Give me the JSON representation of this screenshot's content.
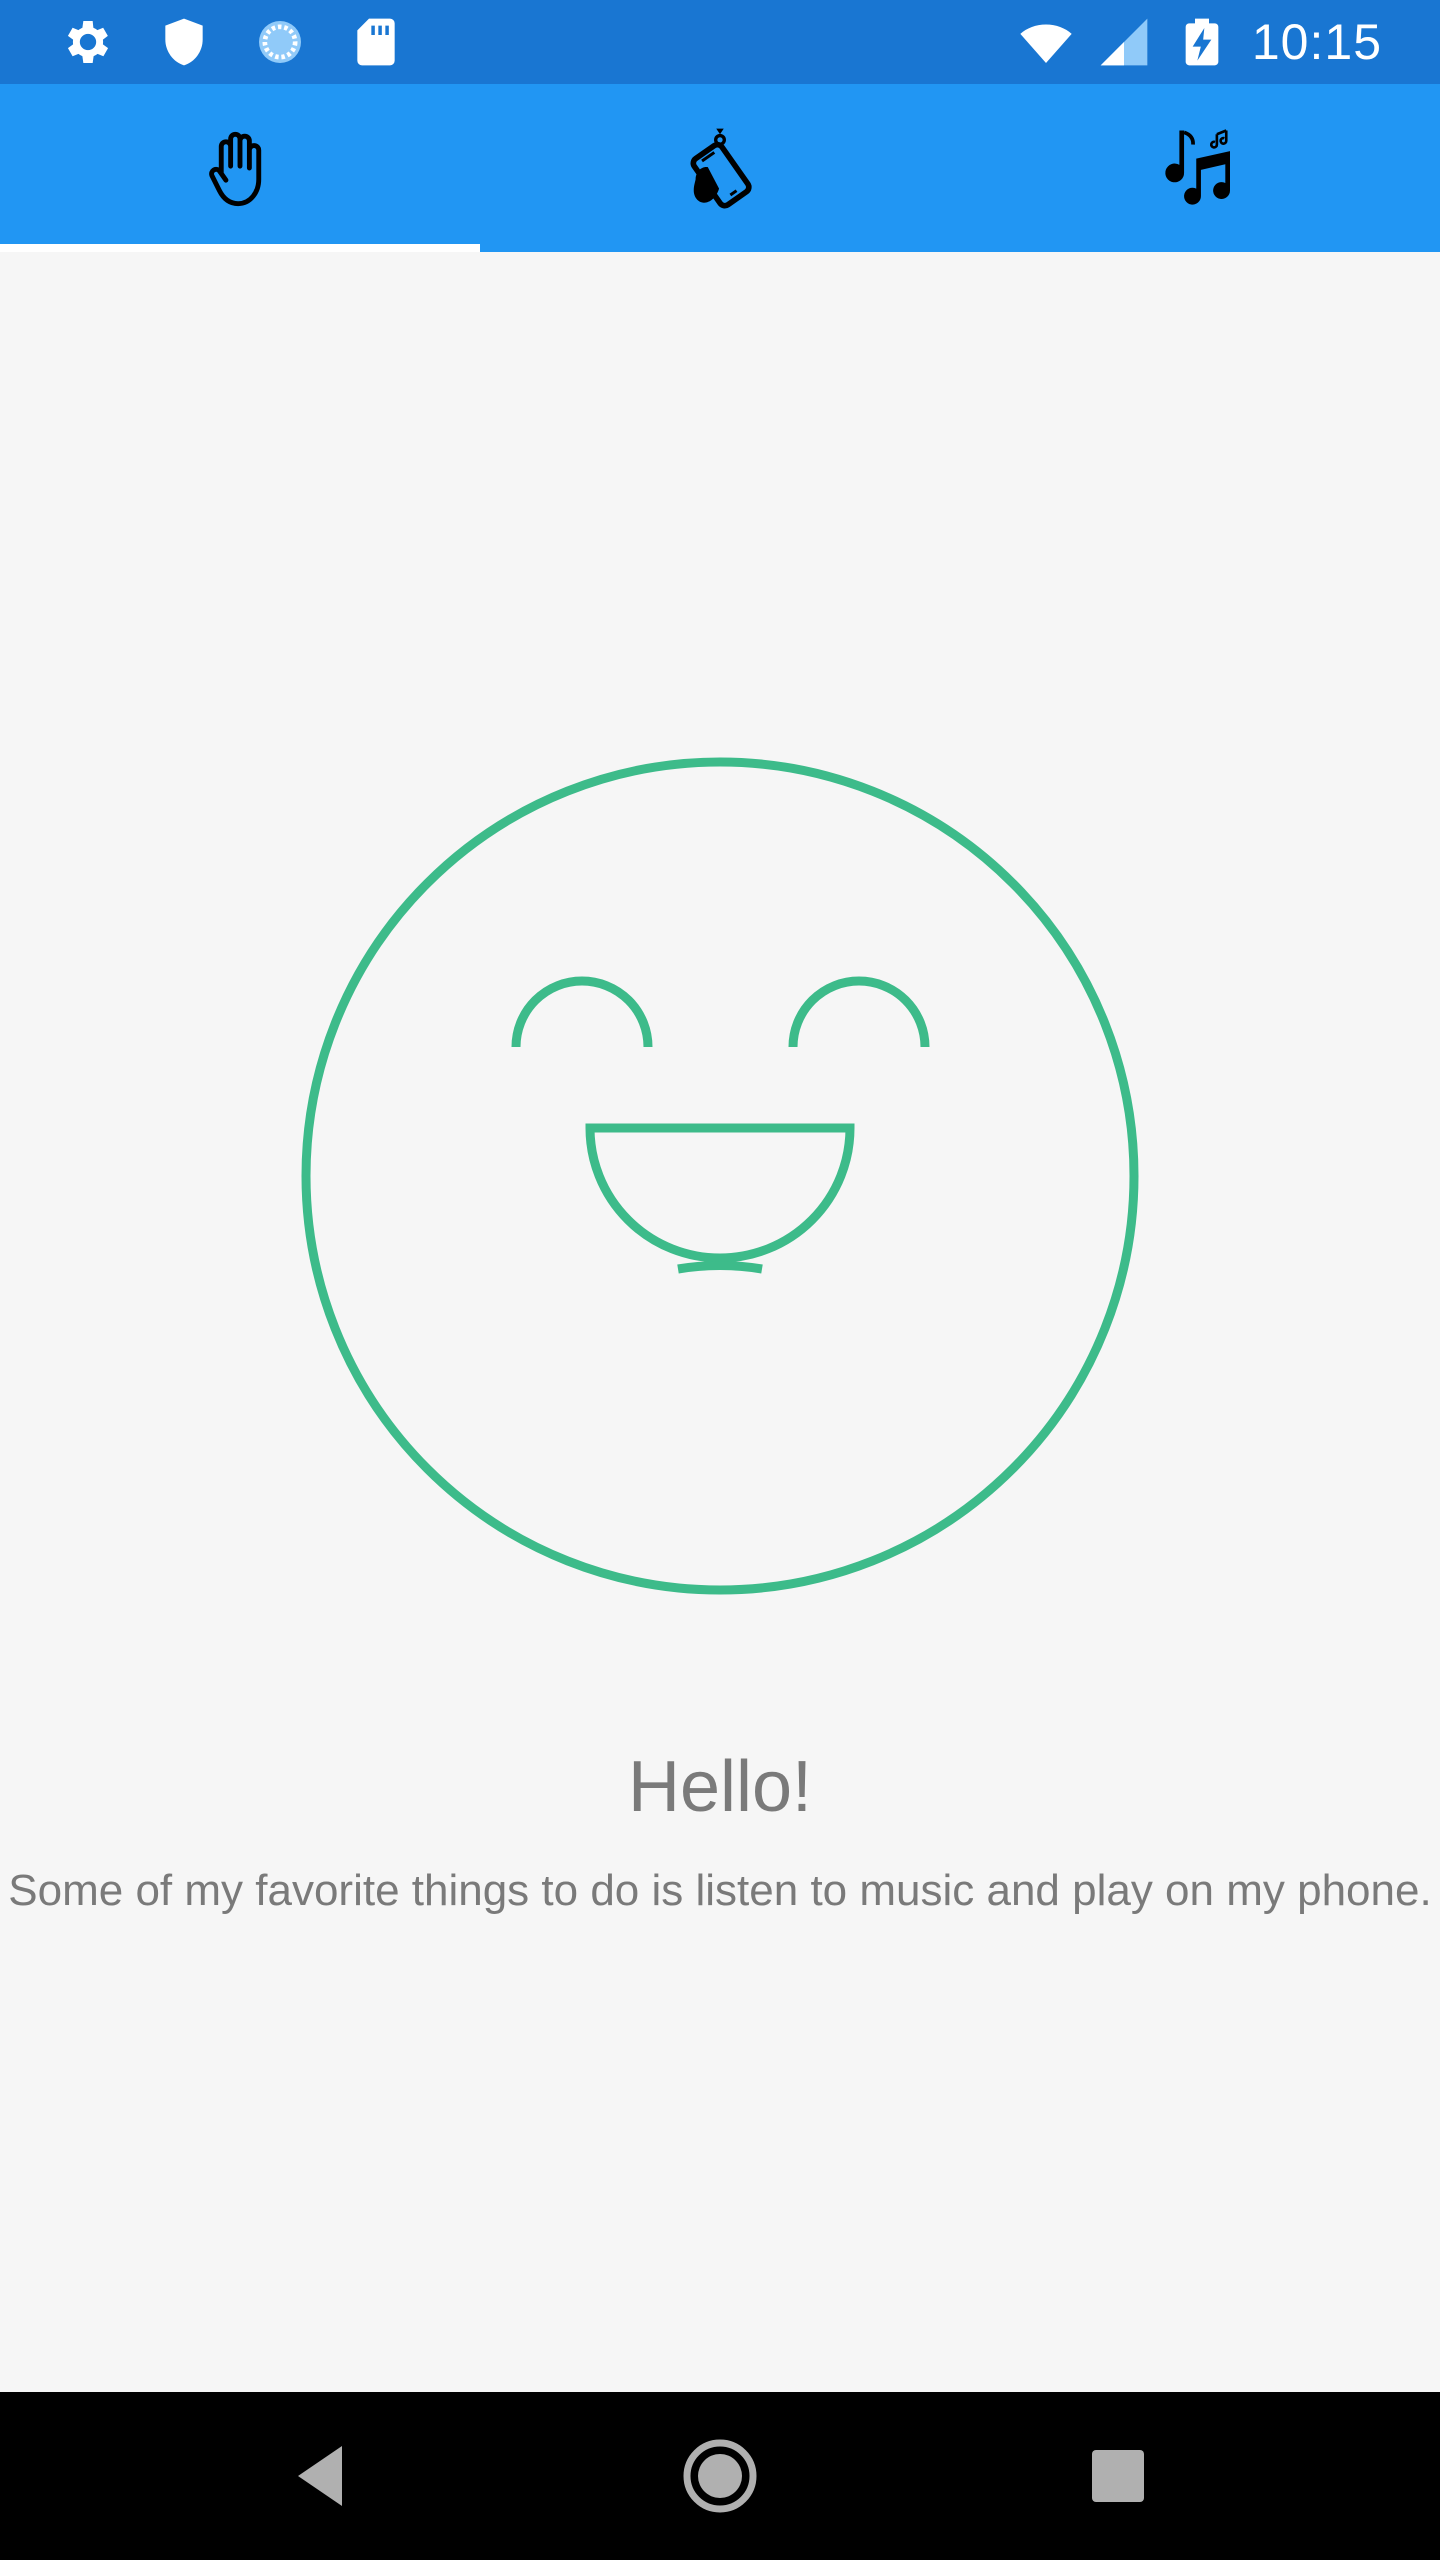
{
  "status_bar": {
    "time": "10:15",
    "left_icons": [
      "gear-icon",
      "shield-icon",
      "sync-icon",
      "sd-card-icon"
    ],
    "right_icons": [
      "wifi-icon",
      "cell-signal-icon",
      "battery-charging-icon"
    ]
  },
  "tabs": [
    {
      "icon": "hand-icon",
      "selected": true
    },
    {
      "icon": "shake-phone-icon",
      "selected": false
    },
    {
      "icon": "music-notes-icon",
      "selected": false
    }
  ],
  "main": {
    "illustration": "smiley-face",
    "greeting": "Hello!",
    "description": "Some of my favorite things to do is listen to music and play on my phone."
  },
  "nav_bar": {
    "buttons": [
      "back-icon",
      "home-icon",
      "recents-icon"
    ]
  },
  "colors": {
    "status_bar": "#1976d2",
    "tab_bar": "#2196f3",
    "accent_green": "#3dbb8a",
    "text_gray": "#7a7a7a",
    "background": "#f6f6f6"
  }
}
